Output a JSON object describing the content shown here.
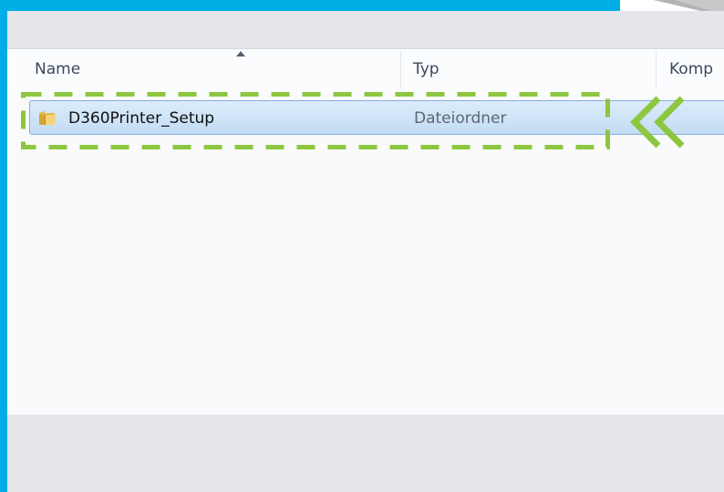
{
  "columns": {
    "name": "Name",
    "type": "Typ",
    "compressed": "Komp"
  },
  "files": [
    {
      "name": "D360Printer_Setup",
      "type": "Dateiordner",
      "icon": "folder-icon",
      "selected": true
    }
  ],
  "colors": {
    "frame_accent": "#00aee6",
    "highlight_annotation": "#8dc63f",
    "selection_fill": "#cfe4f8",
    "selection_border": "#84acdd"
  },
  "annotation": {
    "icon": "double-chevron-left-icon"
  }
}
